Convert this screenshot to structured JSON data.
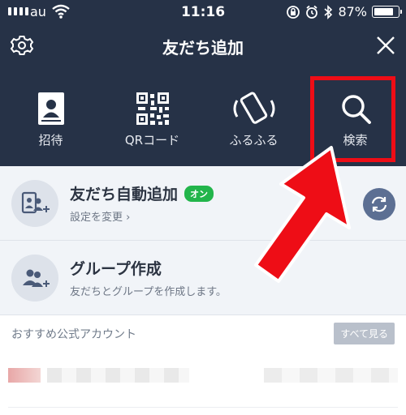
{
  "status": {
    "carrier": "au",
    "time": "11:16",
    "battery": "87%",
    "battery_level": 0.87
  },
  "header": {
    "title": "友だち追加"
  },
  "tabs": [
    {
      "label": "招待",
      "icon": "address-book-icon"
    },
    {
      "label": "QRコード",
      "icon": "qr-code-icon"
    },
    {
      "label": "ふるふる",
      "icon": "shake-phone-icon"
    },
    {
      "label": "検索",
      "icon": "search-icon"
    }
  ],
  "rows": {
    "auto_add": {
      "title": "友だち自動追加",
      "badge": "オン",
      "subtitle": "設定を変更 ›"
    },
    "group": {
      "title": "グループ作成",
      "subtitle": "友だちとグループを作成します。"
    }
  },
  "section": {
    "title": "おすすめ公式アカウント",
    "see_all": "すべて見る"
  },
  "colors": {
    "header_bg": "#263247",
    "highlight": "#ee0d16",
    "badge": "#22b54b",
    "list_bg": "#f1f4f8"
  }
}
